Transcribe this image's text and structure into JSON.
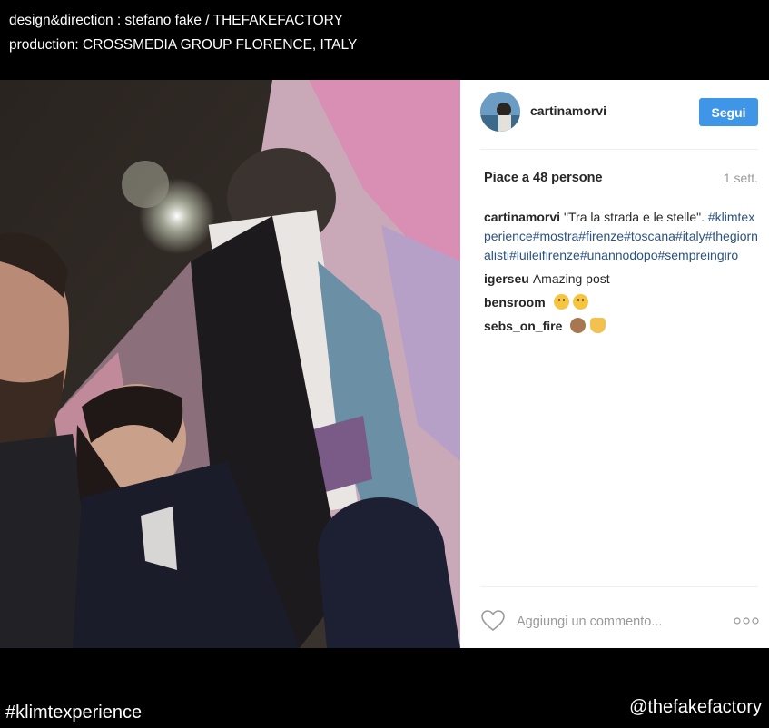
{
  "credits": {
    "line1": "design&direction : stefano fake / THEFAKEFACTORY",
    "line2": "production: CROSSMEDIA GROUP FLORENCE, ITALY"
  },
  "post": {
    "username": "cartinamorvi",
    "follow_label": "Segui",
    "likes_text": "Piace a 48 persone",
    "time_ago": "1 sett.",
    "caption": {
      "user": "cartinamorvi",
      "text": "\"Tra la strada e le stelle\".",
      "hashtags": "#klimtexperience#mostra#firenze#toscana#italy#thegiornalisti#luileifirenze#unannodopo#sempreingiro"
    },
    "comments": [
      {
        "user": "igerseu",
        "text": "Amazing post",
        "emojis": []
      },
      {
        "user": "bensroom",
        "text": "",
        "emojis": [
          "grinning-emoji",
          "grinning-emoji"
        ]
      },
      {
        "user": "sebs_on_fire",
        "text": "",
        "emojis": [
          "see-no-evil-monkey-emoji",
          "raising-hands-emoji"
        ]
      }
    ],
    "comment_placeholder": "Aggiungi un commento...",
    "icons": {
      "like": "heart-icon",
      "more": "more-dots-icon"
    }
  },
  "footer": {
    "hashtag": "#klimtexperience",
    "handle": "@thefakefactory"
  },
  "colors": {
    "follow_button": "#3f96e8",
    "hashtag": "#2b5282",
    "background": "#000000"
  }
}
